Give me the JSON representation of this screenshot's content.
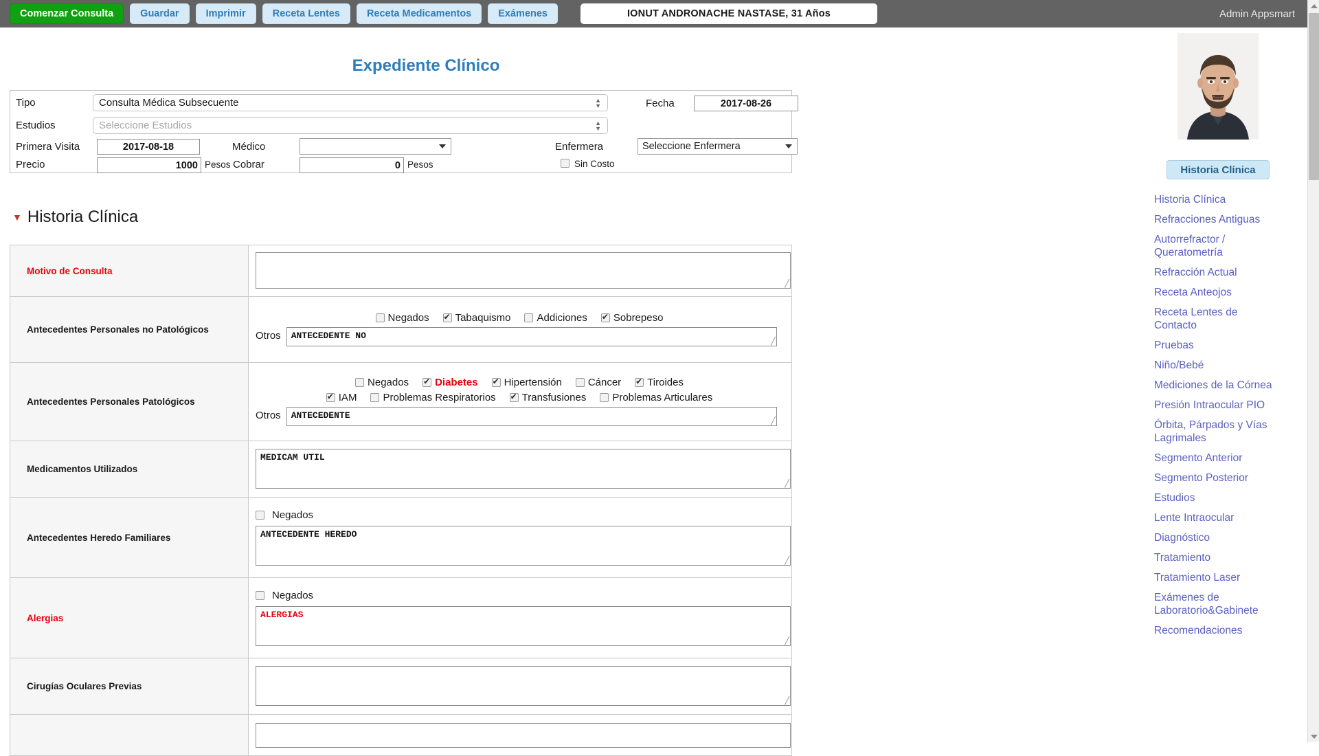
{
  "topbar": {
    "buttons": [
      {
        "label": "Comenzar Consulta",
        "style": "primary"
      },
      {
        "label": "Guardar",
        "style": "normal"
      },
      {
        "label": "Imprimir",
        "style": "normal"
      },
      {
        "label": "Receta Lentes",
        "style": "normal"
      },
      {
        "label": "Receta Medicamentos",
        "style": "normal"
      },
      {
        "label": "Exámenes",
        "style": "normal"
      }
    ],
    "patient_banner": "IONUT ANDRONACHE NASTASE, 31 Años",
    "admin_label": "Admin Appsmart",
    "primary_color": "#11a011",
    "button_bg": "#d6eaf8",
    "button_fg": "#2e7ebb",
    "bar_bg": "#636363"
  },
  "page": {
    "title": "Expediente Clínico",
    "title_color": "#2e7ebb"
  },
  "consulta": {
    "tipo_label": "Tipo",
    "tipo_value": "Consulta Médica Subsecuente",
    "estudios_label": "Estudios",
    "estudios_placeholder": "Seleccione Estudios",
    "fecha_label": "Fecha",
    "fecha_value": "2017-08-26",
    "primera_visita_label": "Primera Visita",
    "primera_visita_value": "2017-08-18",
    "medico_label": "Médico",
    "medico_value": "",
    "enfermera_label": "Enfermera",
    "enfermera_value": "Seleccione Enfermera",
    "precio_label": "Precio",
    "precio_value": "1000",
    "precio_unit": "Pesos",
    "cobrar_label": "Cobrar",
    "cobrar_value": "0",
    "cobrar_unit": "Pesos",
    "sin_costo_label": "Sin Costo",
    "sin_costo_checked": false
  },
  "historia_clinica": {
    "section_title": "Historia Clínica",
    "collapse_icon": "triangle-down-icon",
    "rows": [
      {
        "label": "Motivo de Consulta",
        "required": true,
        "checkboxes": [],
        "text_value": "",
        "text_height": "h58"
      },
      {
        "label": "Antecedentes Personales no Patológicos",
        "required": false,
        "checkbox_rows": [
          [
            {
              "label": "Negados",
              "checked": false,
              "highlight": false
            },
            {
              "label": "Tabaquismo",
              "checked": true,
              "highlight": false
            },
            {
              "label": "Addiciones",
              "checked": false,
              "highlight": false
            },
            {
              "label": "Sobrepeso",
              "checked": true,
              "highlight": false
            }
          ]
        ],
        "otros_label": "Otros",
        "otros_value": "ANTECEDENTE NO"
      },
      {
        "label": "Antecedentes Personales Patológicos",
        "required": false,
        "checkbox_rows": [
          [
            {
              "label": "Negados",
              "checked": false,
              "highlight": false
            },
            {
              "label": "Diabetes",
              "checked": true,
              "highlight": true
            },
            {
              "label": "Hipertensión",
              "checked": true,
              "highlight": false
            },
            {
              "label": "Cáncer",
              "checked": false,
              "highlight": false
            },
            {
              "label": "Tiroides",
              "checked": true,
              "highlight": false
            }
          ],
          [
            {
              "label": "IAM",
              "checked": true,
              "highlight": false
            },
            {
              "label": "Problemas Respiratorios",
              "checked": false,
              "highlight": false
            },
            {
              "label": "Transfusiones",
              "checked": true,
              "highlight": false
            },
            {
              "label": "Problemas Articulares",
              "checked": false,
              "highlight": false
            }
          ]
        ],
        "otros_label": "Otros",
        "otros_value": "ANTECEDENTE"
      },
      {
        "label": "Medicamentos Utilizados",
        "required": false,
        "text_value": "MEDICAM UTIL",
        "text_height": "h58"
      },
      {
        "label": "Antecedentes Heredo Familiares",
        "required": false,
        "negados_label": "Negados",
        "negados_checked": false,
        "text_value": "ANTECEDENTE HEREDO",
        "text_height": "h58"
      },
      {
        "label": "Alergias",
        "required": true,
        "negados_label": "Negados",
        "negados_checked": false,
        "text_value": "ALERGIAS",
        "text_red": true,
        "text_height": "h58"
      },
      {
        "label": "Cirugías Oculares Previas",
        "required": false,
        "text_value": "",
        "text_height": "h58"
      },
      {
        "label": "",
        "required": false,
        "text_value": "",
        "text_height": "h28"
      }
    ]
  },
  "right_panel": {
    "photo_name": "patient-photo",
    "active_pill": "Historia Clínica",
    "nav_items": [
      "Historia Clínica",
      "Refracciones Antiguas",
      "Autorrefractor / Queratometría",
      "Refracción Actual",
      "Receta Anteojos",
      "Receta Lentes de Contacto",
      "Pruebas",
      "Niño/Bebé",
      "Mediciones de la Córnea",
      "Presión Intraocular PIO",
      "Órbita, Párpados y Vías Lagrimales",
      "Segmento Anterior",
      "Segmento Posterior",
      "Estudios",
      "Lente Intraocular",
      "Diagnóstico",
      "Tratamiento",
      "Tratamiento Laser",
      "Exámenes de Laboratorio&Gabinete",
      "Recomendaciones"
    ],
    "nav_color": "#5a60c0",
    "pill_bg": "#cfe8f5"
  },
  "scrollbar": {
    "up_icon": "triangle-up-icon",
    "down_icon": "triangle-down-icon",
    "thumb_position": "top"
  }
}
